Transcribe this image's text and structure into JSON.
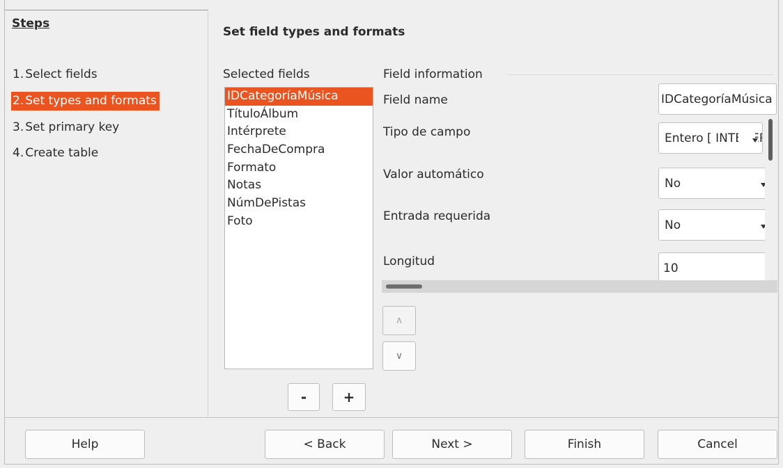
{
  "steps": {
    "title": "Steps",
    "items": [
      {
        "num": "1.",
        "label": "Select fields"
      },
      {
        "num": "2.",
        "label": "Set types and formats"
      },
      {
        "num": "3.",
        "label": "Set primary key"
      },
      {
        "num": "4.",
        "label": "Create table"
      }
    ]
  },
  "page": {
    "title": "Set field types and formats",
    "selected_fields_label": "Selected fields",
    "fields": [
      "IDCategoríaMúsica",
      "TítuloÁlbum",
      "Intérprete",
      "FechaDeCompra",
      "Formato",
      "Notas",
      "NúmDePistas",
      "Foto"
    ],
    "remove_label": "-",
    "add_label": "+",
    "up_label": "∧",
    "down_label": "∨"
  },
  "field_info": {
    "title": "Field information",
    "field_name_label": "Field name",
    "field_name_value": "IDCategoríaMúsica",
    "tipo_label": "Tipo de campo",
    "tipo_value": "Entero [ INTEGER ]",
    "auto_label": "Valor automático",
    "auto_value": "No",
    "required_label": "Entrada requerida",
    "required_value": "No",
    "length_label": "Longitud",
    "length_value": "10"
  },
  "buttons": {
    "help": "Help",
    "back": "< Back",
    "next": "Next >",
    "finish": "Finish",
    "cancel": "Cancel"
  },
  "colors": {
    "accent": "#e95420"
  }
}
